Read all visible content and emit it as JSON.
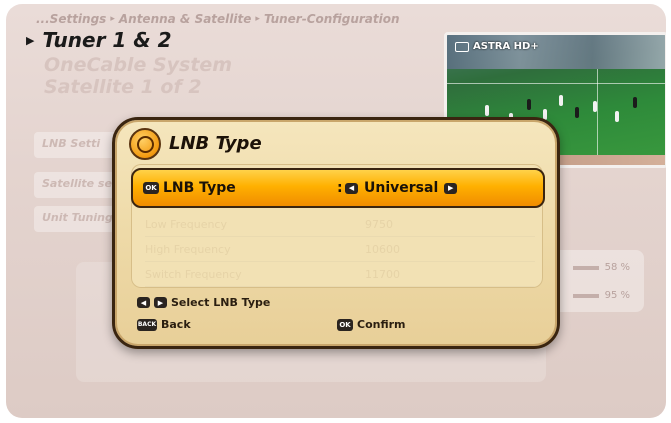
{
  "breadcrumb": [
    "...Settings",
    "Antenna & Satellite",
    "Tuner-Configuration"
  ],
  "tuner_title": "Tuner 1 & 2",
  "subtitles": [
    "OneCable System",
    "Satellite 1 of 2"
  ],
  "background_items": [
    "LNB Setti",
    "Satellite set",
    "Unit Tuning"
  ],
  "background_meters": [
    "58 %",
    "95 %"
  ],
  "preview": {
    "channel": "ASTRA HD+"
  },
  "dialog": {
    "title": "LNB Type",
    "selected_row": {
      "ok_label": "OK",
      "label": "LNB Type",
      "colon": ":",
      "value": "Universal"
    },
    "dim_rows": [
      {
        "label": "Low Frequency",
        "value": "9750"
      },
      {
        "label": "High Frequency",
        "value": "10600"
      },
      {
        "label": "Switch Frequency",
        "value": "11700"
      }
    ],
    "hints": {
      "select": "Select LNB Type",
      "back_key": "BACK",
      "back": "Back",
      "ok_key": "OK",
      "confirm": "Confirm"
    }
  },
  "colors": {
    "accent": "#f5a000",
    "dialog_bg": "#f2e1b4",
    "screen_bg": "#e4d4cf"
  }
}
